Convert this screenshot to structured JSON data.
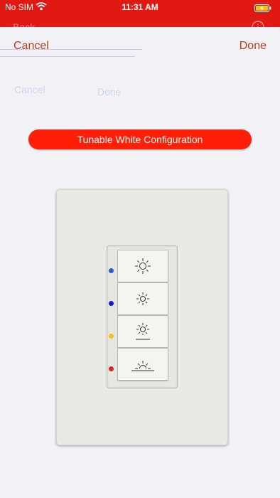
{
  "status_bar": {
    "carrier": "No SIM",
    "time": "11:31 AM"
  },
  "background_nav": {
    "back_label": "Back"
  },
  "sheet": {
    "cancel_label": "Cancel",
    "done_label": "Done",
    "ghost_cancel": "Cancel",
    "ghost_done": "Done",
    "config_button": "Tunable White Configuration"
  },
  "keypad": {
    "buttons": [
      {
        "icon": "sun-icon",
        "led_color": "#2f5bd8"
      },
      {
        "icon": "sun-small-icon",
        "led_color": "#1a1ad8"
      },
      {
        "icon": "sun-horizon-icon",
        "led_color": "#f2c21a"
      },
      {
        "icon": "sunset-icon",
        "led_color": "#d8281a"
      }
    ]
  },
  "colors": {
    "status_bar": "#e01a12",
    "accent_text": "#c0391a",
    "config_button": "#ff1e06",
    "sheet_background": "#f2f1f6"
  }
}
